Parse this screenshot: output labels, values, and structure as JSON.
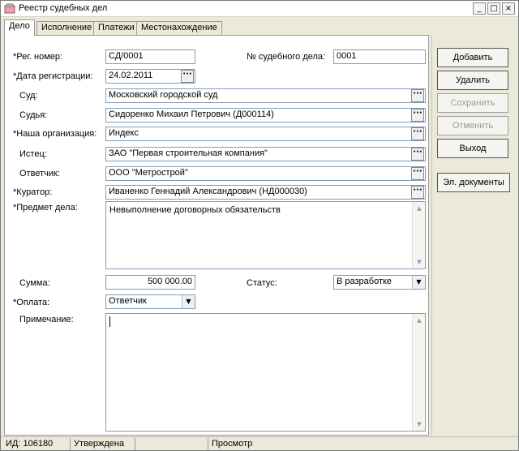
{
  "window": {
    "title": "Реестр судебных дел"
  },
  "titlebar_buttons": {
    "minimize": "_",
    "maximize": "□",
    "close": "×"
  },
  "tabs": [
    "Дело",
    "Исполнение",
    "Платежи",
    "Местонахождение"
  ],
  "form": {
    "reg_number": {
      "label": "*Рег. номер:",
      "value": "СД/0001"
    },
    "court_case_number": {
      "label": "№ судебного дела:",
      "value": "0001"
    },
    "reg_date": {
      "label": "*Дата регистрации:",
      "value": "24.02.2011"
    },
    "court": {
      "label": "Суд:",
      "value": "Московский городской суд"
    },
    "judge": {
      "label": "Судья:",
      "value": "Сидоренко Михаил Петрович (Д000114)"
    },
    "our_org": {
      "label": "*Наша организация:",
      "value": "Индекс"
    },
    "plaintiff": {
      "label": "Истец:",
      "value": "ЗАО \"Первая строительная компания\""
    },
    "defendant": {
      "label": "Ответчик:",
      "value": "ООО \"Метрострой\""
    },
    "curator": {
      "label": "*Куратор:",
      "value": "Иваненко Геннадий Александрович (НД000030)"
    },
    "subject": {
      "label": "*Предмет дела:",
      "value": "Невыполнение договорных обязательств"
    },
    "amount": {
      "label": "Сумма:",
      "value": "500 000.00"
    },
    "status": {
      "label": "Статус:",
      "value": "В разработке"
    },
    "payment": {
      "label": "*Оплата:",
      "value": "Ответчик"
    },
    "note": {
      "label": "Примечание:",
      "value": ""
    }
  },
  "buttons": {
    "add": "Добавить",
    "delete": "Удалить",
    "save": "Сохранить",
    "cancel": "Отменить",
    "exit": "Выход",
    "edocs": "Эл. документы"
  },
  "dots_label": "···",
  "combo_arrow": "▼",
  "scroll_up": "▲",
  "scroll_down": "▼",
  "statusbar": {
    "id": "ИД: 106180",
    "state": "Утверждена",
    "extra": "",
    "mode": "Просмотр"
  }
}
